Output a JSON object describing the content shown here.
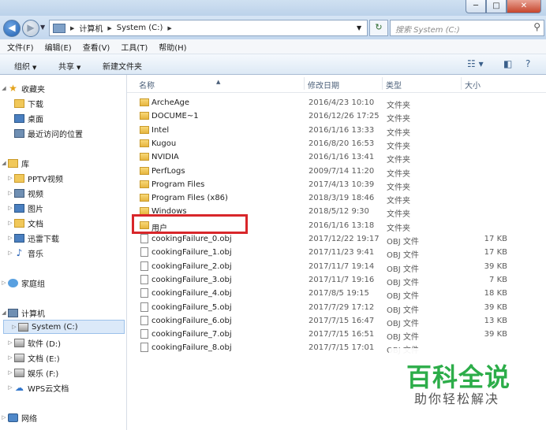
{
  "window": {
    "min": "─",
    "max": "□",
    "close": "✕"
  },
  "address": {
    "path": [
      "计算机",
      "System (C:)"
    ],
    "search_placeholder": "搜索 System (C:)"
  },
  "menu": [
    "文件(F)",
    "编辑(E)",
    "查看(V)",
    "工具(T)",
    "帮助(H)"
  ],
  "toolbar": {
    "organize": "组织",
    "share": "共享",
    "new_folder": "新建文件夹"
  },
  "columns": {
    "name": "名称",
    "date": "修改日期",
    "type": "类型",
    "size": "大小"
  },
  "nav": [
    {
      "label": "收藏夹",
      "icon": "star-icon"
    },
    {
      "label": "下载",
      "icon": "folder-icon"
    },
    {
      "label": "桌面",
      "icon": "desktop-icon"
    },
    {
      "label": "最近访问的位置",
      "icon": "recent-icon"
    },
    {
      "label": "库",
      "icon": "library-icon"
    },
    {
      "label": "PPTV视频",
      "icon": "folder-icon"
    },
    {
      "label": "视频",
      "icon": "video-icon"
    },
    {
      "label": "图片",
      "icon": "picture-icon"
    },
    {
      "label": "文档",
      "icon": "document-icon"
    },
    {
      "label": "迅雷下载",
      "icon": "folder-icon"
    },
    {
      "label": "音乐",
      "icon": "music-icon"
    },
    {
      "label": "家庭组",
      "icon": "homegroup-icon"
    },
    {
      "label": "计算机",
      "icon": "computer-icon"
    },
    {
      "label": "System (C:)",
      "icon": "drive-icon"
    },
    {
      "label": "软件 (D:)",
      "icon": "drive-icon"
    },
    {
      "label": "文档 (E:)",
      "icon": "drive-icon"
    },
    {
      "label": "娱乐 (F:)",
      "icon": "drive-icon"
    },
    {
      "label": "WPS云文档",
      "icon": "cloud-icon"
    },
    {
      "label": "网络",
      "icon": "network-icon"
    }
  ],
  "files": [
    {
      "name": "ArcheAge",
      "date": "2016/4/23 10:10",
      "type": "文件夹",
      "size": "",
      "kind": "folder"
    },
    {
      "name": "DOCUME~1",
      "date": "2016/12/26 17:25",
      "type": "文件夹",
      "size": "",
      "kind": "folder"
    },
    {
      "name": "Intel",
      "date": "2016/1/16 13:33",
      "type": "文件夹",
      "size": "",
      "kind": "folder"
    },
    {
      "name": "Kugou",
      "date": "2016/8/20 16:53",
      "type": "文件夹",
      "size": "",
      "kind": "folder"
    },
    {
      "name": "NVIDIA",
      "date": "2016/1/16 13:41",
      "type": "文件夹",
      "size": "",
      "kind": "folder"
    },
    {
      "name": "PerfLogs",
      "date": "2009/7/14 11:20",
      "type": "文件夹",
      "size": "",
      "kind": "folder"
    },
    {
      "name": "Program Files",
      "date": "2017/4/13 10:39",
      "type": "文件夹",
      "size": "",
      "kind": "folder"
    },
    {
      "name": "Program Files (x86)",
      "date": "2018/3/19 18:46",
      "type": "文件夹",
      "size": "",
      "kind": "folder"
    },
    {
      "name": "Windows",
      "date": "2018/5/12 9:30",
      "type": "文件夹",
      "size": "",
      "kind": "folder"
    },
    {
      "name": "用户",
      "date": "2016/1/16 13:18",
      "type": "文件夹",
      "size": "",
      "kind": "folder"
    },
    {
      "name": "cookingFailure_0.obj",
      "date": "2017/12/22 19:17",
      "type": "OBJ 文件",
      "size": "17 KB",
      "kind": "doc"
    },
    {
      "name": "cookingFailure_1.obj",
      "date": "2017/11/23 9:41",
      "type": "OBJ 文件",
      "size": "17 KB",
      "kind": "doc"
    },
    {
      "name": "cookingFailure_2.obj",
      "date": "2017/11/7 19:14",
      "type": "OBJ 文件",
      "size": "39 KB",
      "kind": "doc"
    },
    {
      "name": "cookingFailure_3.obj",
      "date": "2017/11/7 19:16",
      "type": "OBJ 文件",
      "size": "7 KB",
      "kind": "doc"
    },
    {
      "name": "cookingFailure_4.obj",
      "date": "2017/8/5 19:15",
      "type": "OBJ 文件",
      "size": "18 KB",
      "kind": "doc"
    },
    {
      "name": "cookingFailure_5.obj",
      "date": "2017/7/29 17:12",
      "type": "OBJ 文件",
      "size": "39 KB",
      "kind": "doc"
    },
    {
      "name": "cookingFailure_6.obj",
      "date": "2017/7/15 16:47",
      "type": "OBJ 文件",
      "size": "13 KB",
      "kind": "doc"
    },
    {
      "name": "cookingFailure_7.obj",
      "date": "2017/7/15 16:51",
      "type": "OBJ 文件",
      "size": "39 KB",
      "kind": "doc"
    },
    {
      "name": "cookingFailure_8.obj",
      "date": "2017/7/15 17:01",
      "type": "OBJ 文件",
      "size": "",
      "kind": "doc"
    }
  ],
  "watermark": {
    "title": "百科全说",
    "subtitle": "助你轻松解决"
  }
}
